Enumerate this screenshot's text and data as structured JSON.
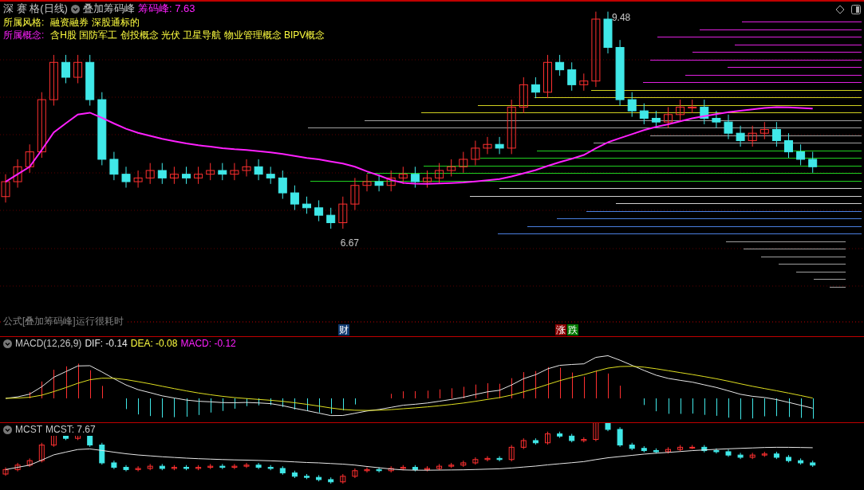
{
  "header": {
    "stock": "深 赛 格(日线)",
    "indicator": "叠加筹码峰",
    "reading_label": "筹码峰:",
    "reading": "7.63"
  },
  "info": [
    {
      "label": "所属风格:",
      "value": "融资融券 深股通标的",
      "kind": "style"
    },
    {
      "label": "所属概念:",
      "value": "含H股 国防军工 创投概念 光伏 卫星导航 物业管理概念 BIPV概念",
      "kind": "concept"
    }
  ],
  "price_labels": {
    "high": "9.48",
    "low": "6.67"
  },
  "notice": "公式[叠加筹码峰]运行很耗时",
  "event_badges": [
    {
      "text": "财",
      "kind": "finance"
    },
    {
      "text": "涨",
      "kind": "up"
    },
    {
      "text": "跌",
      "kind": "down"
    }
  ],
  "macd": {
    "name": "MACD(12,26,9)",
    "dif": "DIF: -0.14",
    "dea": "DEA: -0.08",
    "macd": "MACD: -0.12"
  },
  "mcst": {
    "name": "MCST",
    "reading": "MCST: 7.67"
  }
}
